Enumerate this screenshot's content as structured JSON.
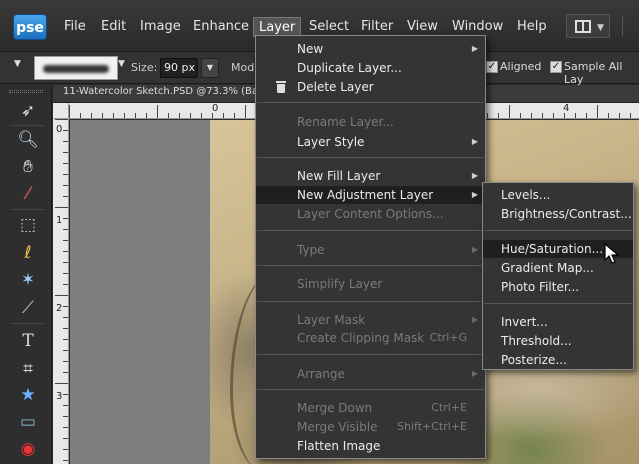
{
  "app": {
    "logo": "pse"
  },
  "menubar": {
    "items": [
      "File",
      "Edit",
      "Image",
      "Enhance",
      "Layer",
      "Select",
      "Filter",
      "View",
      "Window",
      "Help"
    ],
    "active": "Layer"
  },
  "options_bar": {
    "size_label": "Size:",
    "size_value": "90 px",
    "mode_label": "Mod",
    "aligned_label": "Aligned",
    "sample_label": "Sample All Lay"
  },
  "document": {
    "tab_title": "11-Watercolor Sketch.PSD @73.3% (Back",
    "ruler_top": [
      "0",
      "4"
    ],
    "ruler_left": [
      "0",
      "1",
      "2",
      "3"
    ]
  },
  "layer_menu": {
    "items": [
      {
        "label": "New",
        "enabled": true,
        "submenu": true
      },
      {
        "label": "Duplicate Layer...",
        "enabled": true
      },
      {
        "label": "Delete Layer",
        "enabled": true,
        "icon": "trash-icon"
      },
      {
        "label": "Rename Layer...",
        "enabled": false
      },
      {
        "label": "Layer Style",
        "enabled": true,
        "submenu": true
      },
      {
        "label": "New Fill Layer",
        "enabled": true,
        "submenu": true
      },
      {
        "label": "New Adjustment Layer",
        "enabled": true,
        "submenu": true,
        "highlighted": true
      },
      {
        "label": "Layer Content Options...",
        "enabled": false
      },
      {
        "label": "Type",
        "enabled": false,
        "submenu": true
      },
      {
        "label": "Simplify Layer",
        "enabled": false
      },
      {
        "label": "Layer Mask",
        "enabled": false,
        "submenu": true
      },
      {
        "label": "Create Clipping Mask",
        "enabled": false,
        "shortcut": "Ctrl+G"
      },
      {
        "label": "Arrange",
        "enabled": false,
        "submenu": true
      },
      {
        "label": "Merge Down",
        "enabled": false,
        "shortcut": "Ctrl+E"
      },
      {
        "label": "Merge Visible",
        "enabled": false,
        "shortcut": "Shift+Ctrl+E"
      },
      {
        "label": "Flatten Image",
        "enabled": true
      }
    ]
  },
  "adjustment_menu": {
    "items": [
      {
        "label": "Levels...",
        "highlighted": false
      },
      {
        "label": "Brightness/Contrast...",
        "highlighted": false
      },
      {
        "label": "Hue/Saturation...",
        "highlighted": true
      },
      {
        "label": "Gradient Map...",
        "highlighted": false
      },
      {
        "label": "Photo Filter...",
        "highlighted": false
      },
      {
        "label": "Invert...",
        "highlighted": false
      },
      {
        "label": "Threshold...",
        "highlighted": false
      },
      {
        "label": "Posterize...",
        "highlighted": false
      }
    ]
  },
  "toolbox": {
    "tools": [
      "move-tool",
      "zoom-tool",
      "hand-tool",
      "eyedropper-tool",
      "rectangular-marquee-tool",
      "lasso-tool",
      "magic-wand-tool",
      "selection-brush-tool",
      "type-tool",
      "crop-tool",
      "cookie-cutter-tool",
      "straighten-tool",
      "red-eye-tool"
    ]
  }
}
